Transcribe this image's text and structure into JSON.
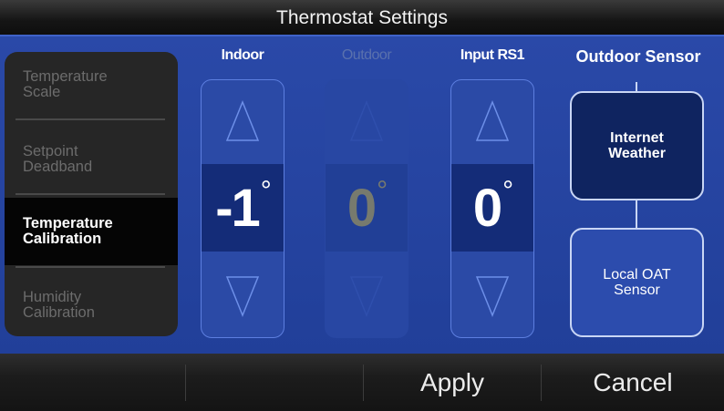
{
  "header": {
    "title": "Thermostat Settings"
  },
  "sidebar": {
    "items": [
      {
        "label": "Temperature\nScale",
        "active": false
      },
      {
        "label": "Setpoint\nDeadband",
        "active": false
      },
      {
        "label": "Temperature\nCalibration",
        "active": true
      },
      {
        "label": "Humidity\nCalibration",
        "active": false
      }
    ]
  },
  "columns": {
    "indoor": {
      "label": "Indoor",
      "value": "-1",
      "degree": "°",
      "enabled": true
    },
    "outdoor": {
      "label": "Outdoor",
      "value": "0",
      "degree": "°",
      "enabled": false
    },
    "input_rs1": {
      "label": "Input RS1",
      "value": "0",
      "degree": "°",
      "enabled": true
    }
  },
  "outdoor_sensor": {
    "title": "Outdoor Sensor",
    "options": [
      {
        "label": "Internet\nWeather",
        "selected": true
      },
      {
        "label": "Local OAT\nSensor",
        "selected": false
      }
    ]
  },
  "footer": {
    "buttons": [
      "",
      "",
      "Apply",
      "Cancel"
    ]
  },
  "colors": {
    "panel_blue": "#23409a",
    "value_box": "#142c78",
    "selected_option": "#0f2460",
    "sidebar_bg": "#262626",
    "active_item": "#050505"
  },
  "icons": {
    "increase": "up-triangle-icon",
    "decrease": "down-triangle-icon"
  }
}
